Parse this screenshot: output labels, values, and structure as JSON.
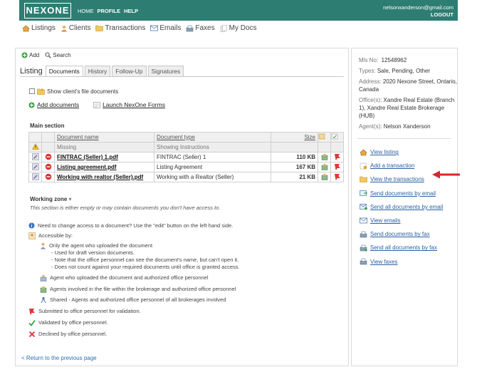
{
  "header": {
    "logo": "NEXONE",
    "nav": [
      "HOME",
      "PROFILE",
      "HELP"
    ],
    "user_email": "nelsonxanderson@gmail.com",
    "logout": "LOGOUT"
  },
  "main_nav": [
    {
      "label": "Listings",
      "icon": "house-icon"
    },
    {
      "label": "Clients",
      "icon": "person-icon"
    },
    {
      "label": "Transactions",
      "icon": "folder-icon"
    },
    {
      "label": "Emails",
      "icon": "envelope-icon"
    },
    {
      "label": "Faxes",
      "icon": "fax-icon"
    },
    {
      "label": "My Docs",
      "icon": "documents-icon"
    }
  ],
  "toolbar": {
    "add": "Add",
    "search": "Search"
  },
  "tabs": {
    "title": "Listing",
    "items": [
      "Documents",
      "History",
      "Follow-Up",
      "Signatures"
    ],
    "active": "Documents"
  },
  "show_client_docs": "Show client's file documents",
  "links": {
    "add_documents": "Add documents",
    "launch_forms": "Launch NexOne Forms"
  },
  "main_section": {
    "title": "Main section",
    "columns": {
      "name": "Document name",
      "type": "Document type",
      "size": "Size"
    },
    "missing": {
      "name": "Missing",
      "type": "Showing Instructions"
    },
    "rows": [
      {
        "name": "FINTRAC (Seller) 1.pdf",
        "type": "FINTRAC (Seller) 1",
        "size": "110 KB"
      },
      {
        "name": "Listing agreement.pdf",
        "type": "Listing Agreement",
        "size": "167 KB"
      },
      {
        "name": "Working with realtor (Seller).pdf",
        "type": "Working with a Realtor (Seller)",
        "size": "21 KB"
      }
    ]
  },
  "working_zone": {
    "title": "Working zone",
    "desc": "This section is either empty or may contain documents you don't have access to."
  },
  "legend": {
    "need_access": "Need to change access to a document? Use the \"edit\" button on the left hand side.",
    "accessible_by": "Accessible by:",
    "only_agent": "Only the agent who uploaded the document",
    "only_agent_notes": [
      "- Used for draft version documents.",
      "- Note that the office personnel can see the document's name, but can't open it.",
      "- Does not count against your required documents until office is granted access."
    ],
    "agent_office": "Agent who uploaded the document and authorized office personnel",
    "agents_brokerage": "Agents involved in the file within the brokerage and authorized office personnel",
    "shared": "Shared - Agents and authorized office personnel of all brokerages involved",
    "submitted": "Submitted to office personnel for validation.",
    "validated": "Validated by office personnel.",
    "declined": "Declined by office personnel."
  },
  "back_link": "< Return to the previous page",
  "listing_info": {
    "mls_label": "Mls No:",
    "mls_value": "12548962",
    "types_label": "Types:",
    "types_value": "Sale, Pending, Other",
    "address_label": "Address:",
    "address_value": "2020 Nexone Street, Ontario, Canada",
    "offices_label": "Office(s):",
    "offices_value": "Xandre Real Estate (Branch 1), Xandre Real Estate Brokerage (HUB)",
    "agents_label": "Agent(s):",
    "agents_value": "Nelson Xanderson"
  },
  "actions": [
    {
      "label": "View listing",
      "icon": "house-icon"
    },
    {
      "label": "Add a transaction",
      "icon": "add-transaction-icon"
    },
    {
      "label": "View the transactions",
      "icon": "folder-icon"
    },
    {
      "label": "Send documents by email",
      "icon": "email-send-icon"
    },
    {
      "label": "Send all documents by email",
      "icon": "email-send-all-icon"
    },
    {
      "label": "View emails",
      "icon": "envelope-icon"
    },
    {
      "label": "Send documents by fax",
      "icon": "fax-send-icon"
    },
    {
      "label": "Send all documents by fax",
      "icon": "fax-send-all-icon"
    },
    {
      "label": "View faxes",
      "icon": "fax-icon"
    }
  ],
  "colors": {
    "header_bg": "#2e7d72",
    "link": "#2a5fa0",
    "arrow": "#d9262b"
  }
}
